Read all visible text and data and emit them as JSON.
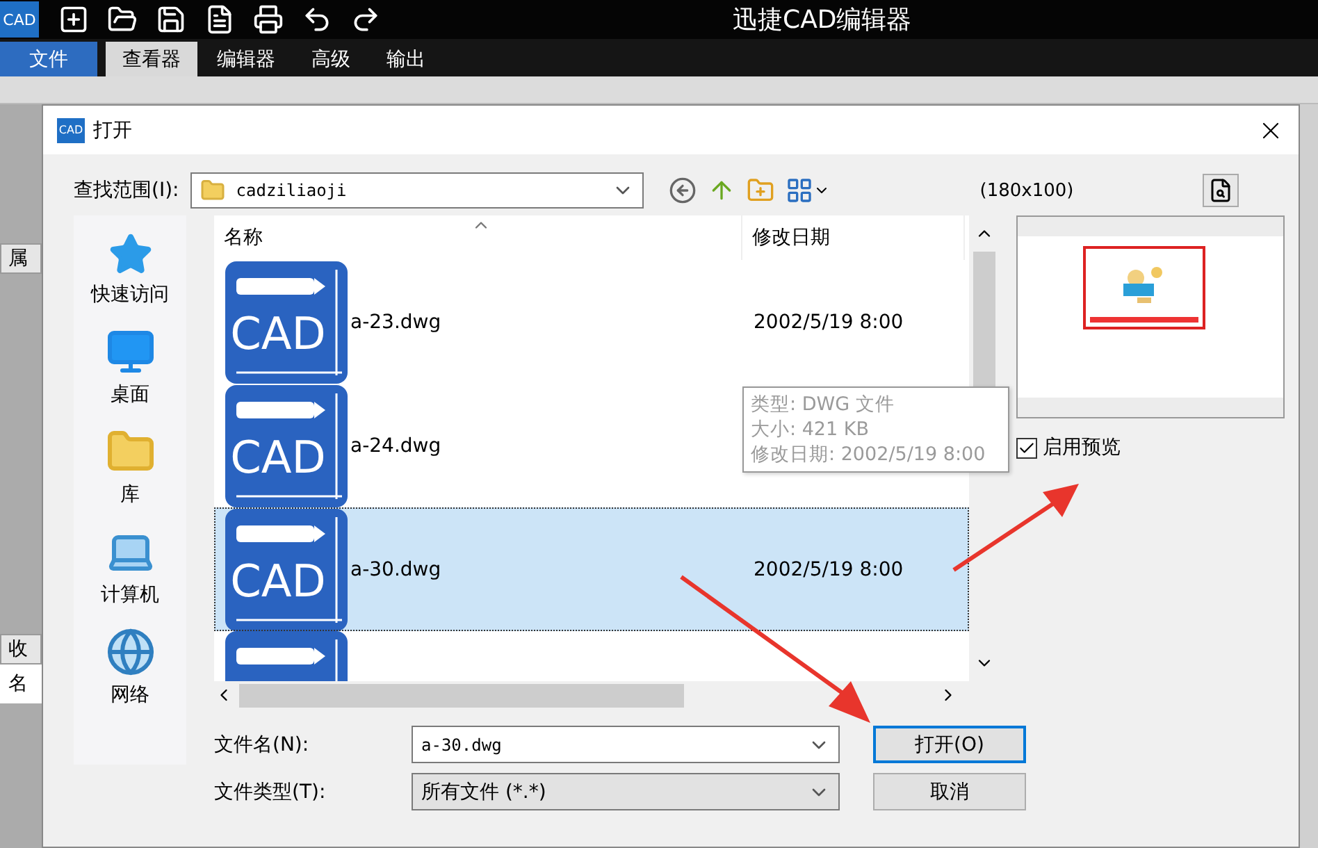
{
  "app": {
    "logo": "CAD",
    "title": "迅捷CAD编辑器",
    "menu_tabs": [
      {
        "label": "文件",
        "kind": "file",
        "selected": false
      },
      {
        "label": "查看器",
        "kind": "tab",
        "selected": true
      },
      {
        "label": "编辑器",
        "kind": "tab",
        "selected": false
      },
      {
        "label": "高级",
        "kind": "tab",
        "selected": false
      },
      {
        "label": "输出",
        "kind": "tab",
        "selected": false
      }
    ],
    "side_panel_labels": [
      "属",
      "收",
      "名"
    ]
  },
  "dialog": {
    "icon_label": "CAD",
    "title": "打开",
    "look_in_label": "查找范围(I):",
    "look_in": "cadziliaoji",
    "preview_size": "(180x100)",
    "places": [
      {
        "label": "快速访问",
        "kind": "quick"
      },
      {
        "label": "桌面",
        "kind": "desktop"
      },
      {
        "label": "库",
        "kind": "library"
      },
      {
        "label": "计算机",
        "kind": "computer"
      },
      {
        "label": "网络",
        "kind": "network"
      }
    ],
    "columns": [
      "名称",
      "修改日期"
    ],
    "files": [
      {
        "icon_text": "CAD",
        "name": "a-23.dwg",
        "date": "2002/5/19 8:00",
        "selected": false
      },
      {
        "icon_text": "CAD",
        "name": "a-24.dwg",
        "selected": false
      },
      {
        "icon_text": "CAD",
        "name": "a-30.dwg",
        "date": "2002/5/19 8:00",
        "selected": true
      },
      {
        "selected": false
      }
    ],
    "tooltip": [
      "类型: DWG 文件",
      "大小: 421 KB",
      "修改日期: 2002/5/19 8:00"
    ],
    "file_name_label": "文件名(N):",
    "file_name": "a-30.dwg",
    "file_type_label": "文件类型(T):",
    "file_type": "所有文件 (*.*)",
    "buttons": [
      {
        "label": "打开(O)",
        "default": true
      },
      {
        "label": "取消",
        "default": false
      }
    ],
    "preview_enabled": {
      "label": "启用预览",
      "checked": true
    }
  }
}
